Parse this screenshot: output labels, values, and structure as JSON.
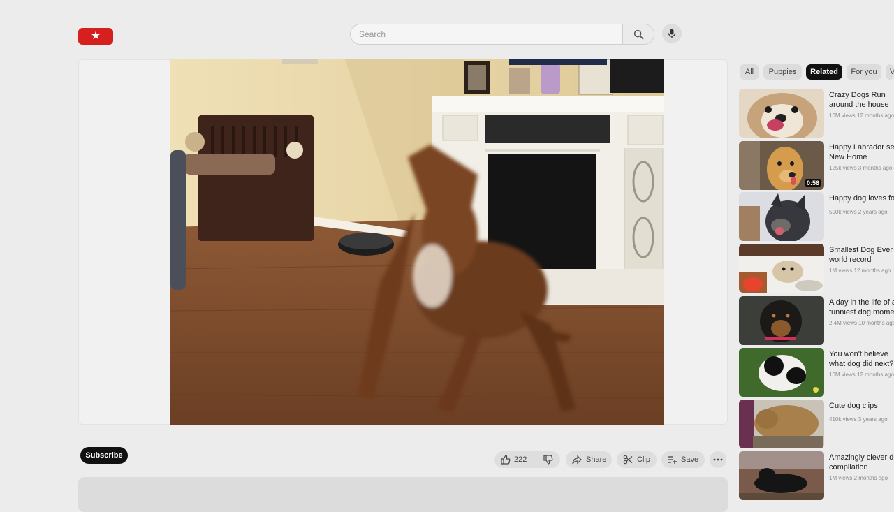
{
  "header": {
    "search_placeholder": "Search"
  },
  "colors": {
    "brand": "#d62020",
    "active_chip": "#111111"
  },
  "icons": {
    "logo": "star-icon",
    "search": "search-icon",
    "mic": "mic-icon",
    "like": "thumbs-up-icon",
    "dislike": "thumbs-down-icon",
    "share": "share-icon",
    "clip": "scissors-icon",
    "save": "playlist-add-icon",
    "more": "more-horizontal-icon"
  },
  "actions": {
    "subscribe": "Subscribe",
    "like_count": "222",
    "share": "Share",
    "clip": "Clip",
    "save": "Save"
  },
  "chips": [
    {
      "label": "All",
      "active": false
    },
    {
      "label": "Puppies",
      "active": false
    },
    {
      "label": "Related",
      "active": true
    },
    {
      "label": "For you",
      "active": false
    },
    {
      "label": "V",
      "active": false
    }
  ],
  "recommendations": [
    {
      "title": "Crazy Dogs Run around the house",
      "meta": "10M views  12 months ago",
      "duration": ""
    },
    {
      "title": "Happy Labrador sees New Home",
      "meta": "125k views  3 months ago",
      "duration": "0:56"
    },
    {
      "title": "Happy dog loves food",
      "meta": "500k views  2 years ago",
      "duration": ""
    },
    {
      "title": "Smallest Dog Ever - world record",
      "meta": "1M views  12 months ago",
      "duration": ""
    },
    {
      "title": "A day in the life of a funniest dog moments",
      "meta": "2.4M views  10 months ago",
      "duration": ""
    },
    {
      "title": "You won't believe what dog did next?",
      "meta": "10M views  12 months ago",
      "duration": ""
    },
    {
      "title": "Cute dog clips",
      "meta": "410k views  3 years ago",
      "duration": ""
    },
    {
      "title": "Amazingly clever dog compilation",
      "meta": "1M views  2 months ago",
      "duration": ""
    }
  ]
}
